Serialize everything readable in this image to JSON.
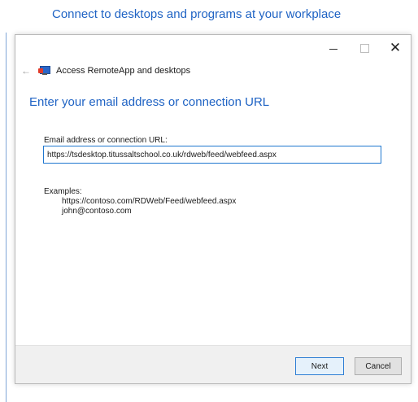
{
  "heading": "Connect to desktops and programs at your workplace",
  "window": {
    "title": "Access RemoteApp and desktops",
    "controls": {
      "minimize_icon": "minimize-icon",
      "maximize_icon": "maximize-icon",
      "close_icon": "close-icon",
      "close_glyph": "✕"
    },
    "back_icon": "back-arrow-icon",
    "back_glyph": "←",
    "subtitle": "Enter your email address or connection URL",
    "field_label": "Email address or connection URL:",
    "field_value": "https://tsdesktop.titussaltschool.co.uk/rdweb/feed/webfeed.aspx",
    "examples_label": "Examples:",
    "examples": [
      "https://contoso.com/RDWeb/Feed/webfeed.aspx",
      "john@contoso.com"
    ],
    "buttons": {
      "next": "Next",
      "cancel": "Cancel"
    }
  },
  "colors": {
    "accent": "#1f63c4",
    "input_border": "#1f77d0",
    "footer_bg": "#f0f0f0"
  }
}
